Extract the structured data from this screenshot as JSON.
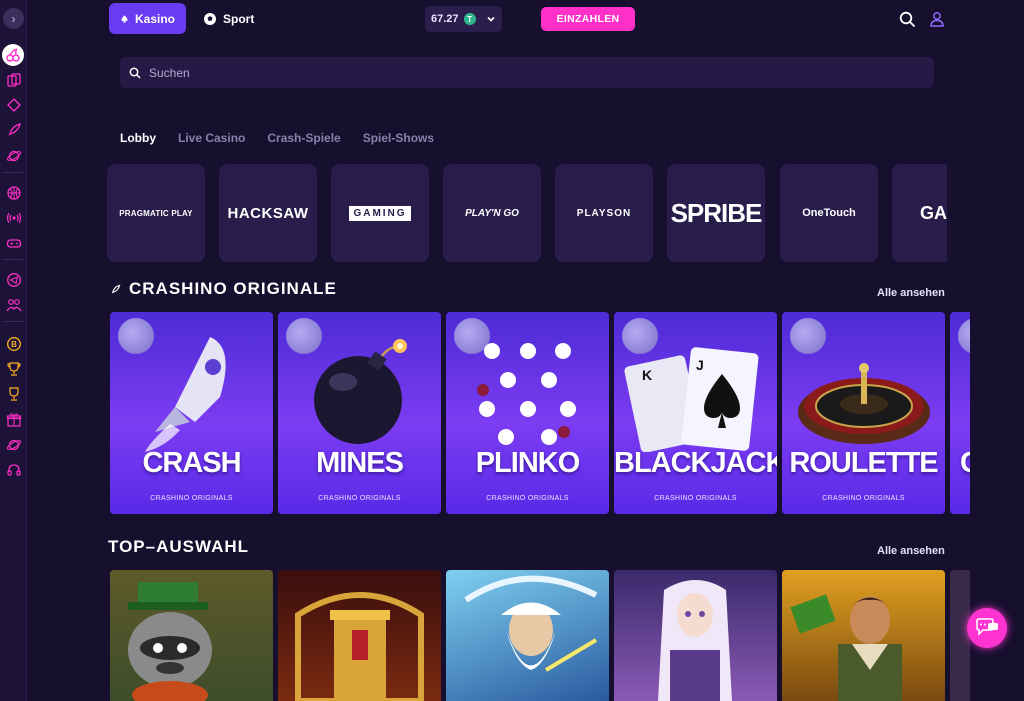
{
  "header": {
    "kasino_label": "Kasino",
    "sport_label": "Sport",
    "balance": "67.27",
    "deposit_label": "EINZAHLEN"
  },
  "search": {
    "placeholder": "Suchen"
  },
  "tabs": [
    {
      "label": "Lobby",
      "active": true
    },
    {
      "label": "Live Casino",
      "active": false
    },
    {
      "label": "Crash-Spiele",
      "active": false
    },
    {
      "label": "Spiel-Shows",
      "active": false
    }
  ],
  "providers": [
    "PRAGMATIC PLAY",
    "HACKSAW",
    "GAMING",
    "PLAY'N GO",
    "PLAYSON",
    "SPRIBE",
    "OneTouch",
    "GAM"
  ],
  "originals": {
    "title": "CRASHINO ORIGINALE",
    "see_all": "Alle ansehen",
    "games": [
      {
        "name": "CRASH",
        "sub": "CRASHINO ORIGINALS"
      },
      {
        "name": "MINES",
        "sub": "CRASHINO ORIGINALS"
      },
      {
        "name": "PLINKO",
        "sub": "CRASHINO ORIGINALS"
      },
      {
        "name": "BLACKJACK",
        "sub": "CRASHINO ORIGINALS"
      },
      {
        "name": "ROULETTE",
        "sub": "CRASHINO ORIGINALS"
      },
      {
        "name": "C",
        "sub": ""
      }
    ]
  },
  "top": {
    "title": "TOP–AUSWAHL",
    "see_all": "Alle ansehen"
  },
  "colors": {
    "background": "#170f2e",
    "accent_purple": "#6a3bf0",
    "accent_pink": "#ff2fc8"
  },
  "icons": [
    "menu-toggle-icon",
    "cherry-icon",
    "cards-icon",
    "diamond-icon",
    "rocket-icon",
    "planet-icon",
    "basketball-icon",
    "live-icon",
    "gamepad-icon",
    "telegram-icon",
    "affiliate-icon",
    "bitcoin-icon",
    "trophy-icon",
    "trophy-icon",
    "gift-icon",
    "planet-icon",
    "headset-icon",
    "search-icon",
    "user-icon",
    "chat-icon"
  ]
}
